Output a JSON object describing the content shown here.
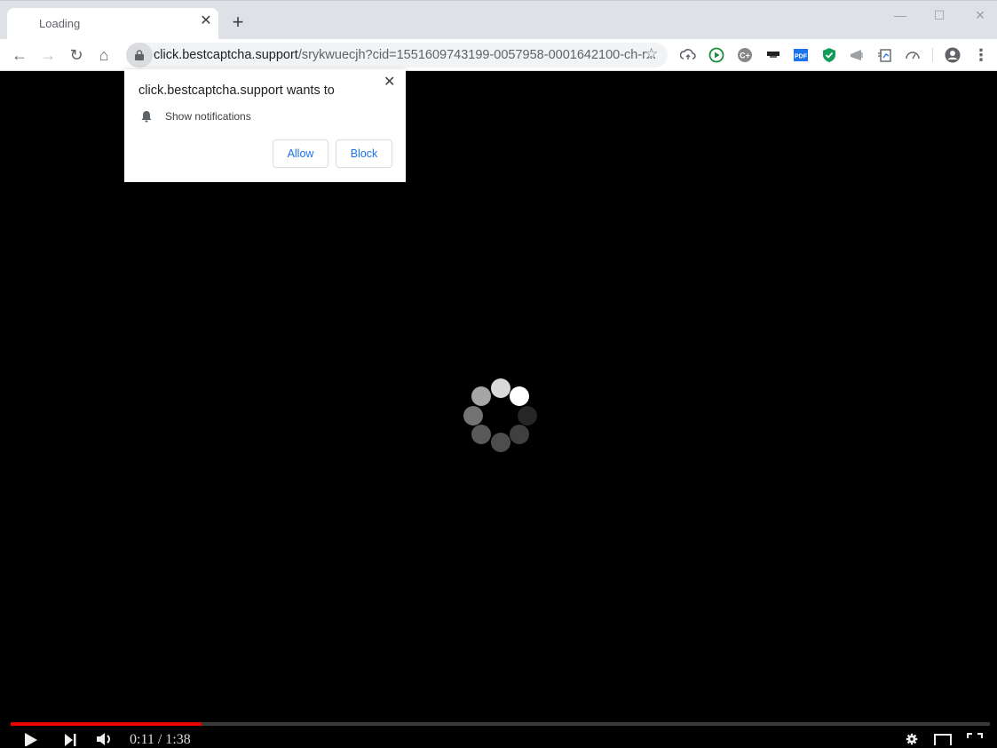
{
  "browser": {
    "tab": {
      "title": "Loading",
      "close_glyph": "✕"
    },
    "new_tab_glyph": "+",
    "window_controls": {
      "minimize": "—",
      "maximize": "☐",
      "close": "✕"
    },
    "nav": {
      "back": "←",
      "forward": "→",
      "reload": "↻",
      "home": "⌂"
    },
    "omnibox": {
      "domain": "click.bestcaptcha.support",
      "path": "/srykwuecjh?cid=1551609743199-0057958-0001642100-ch-r...",
      "bookmark_glyph": "☆"
    },
    "extensions": [
      "cloud-upload-icon",
      "play-circle-icon",
      "grammar-plus-icon",
      "dark-card-icon",
      "pdf-icon",
      "green-shield-icon",
      "megaphone-icon",
      "screenshot-icon",
      "speedometer-icon"
    ],
    "extension_labels": {
      "pdf": "PDF"
    },
    "menu_glyph": "⋮"
  },
  "notification_prompt": {
    "title": "click.bestcaptcha.support wants to",
    "permission": "Show notifications",
    "close_glyph": "✕",
    "allow_label": "Allow",
    "block_label": "Block",
    "accent_color": "#1a73e8"
  },
  "video_player": {
    "current_time": "0:11",
    "duration": "1:38",
    "time_display": "0:11 / 1:38",
    "progress_fraction": 0.195,
    "progress_color": "#ee0000",
    "spinner_opacities": [
      0.85,
      1.0,
      0.15,
      0.25,
      0.3,
      0.35,
      0.45,
      0.65
    ]
  }
}
